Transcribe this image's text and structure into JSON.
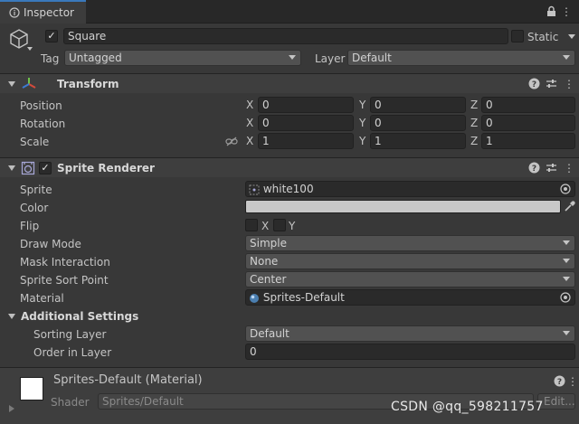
{
  "tab": {
    "label": "Inspector"
  },
  "object": {
    "active": true,
    "name": "Square",
    "static_label": "Static",
    "static_checked": false,
    "tag_label": "Tag",
    "tag_value": "Untagged",
    "layer_label": "Layer",
    "layer_value": "Default"
  },
  "transform": {
    "title": "Transform",
    "position": {
      "label": "Position",
      "x": "0",
      "y": "0",
      "z": "0"
    },
    "rotation": {
      "label": "Rotation",
      "x": "0",
      "y": "0",
      "z": "0"
    },
    "scale": {
      "label": "Scale",
      "x": "1",
      "y": "1",
      "z": "1"
    },
    "axis_x": "X",
    "axis_y": "Y",
    "axis_z": "Z"
  },
  "sprite_renderer": {
    "title": "Sprite Renderer",
    "enabled": true,
    "sprite_label": "Sprite",
    "sprite_value": "white100",
    "color_label": "Color",
    "color_value": "#c8c8c8",
    "flip_label": "Flip",
    "flip_x": "X",
    "flip_y": "Y",
    "draw_mode_label": "Draw Mode",
    "draw_mode_value": "Simple",
    "mask_label": "Mask Interaction",
    "mask_value": "None",
    "sort_point_label": "Sprite Sort Point",
    "sort_point_value": "Center",
    "material_label": "Material",
    "material_value": "Sprites-Default",
    "additional_label": "Additional Settings",
    "sorting_layer_label": "Sorting Layer",
    "sorting_layer_value": "Default",
    "order_label": "Order in Layer",
    "order_value": "0"
  },
  "material": {
    "title": "Sprites-Default (Material)",
    "shader_label": "Shader",
    "shader_value": "Sprites/Default",
    "edit_label": "Edit..."
  },
  "watermark": "CSDN @qq_598211757"
}
